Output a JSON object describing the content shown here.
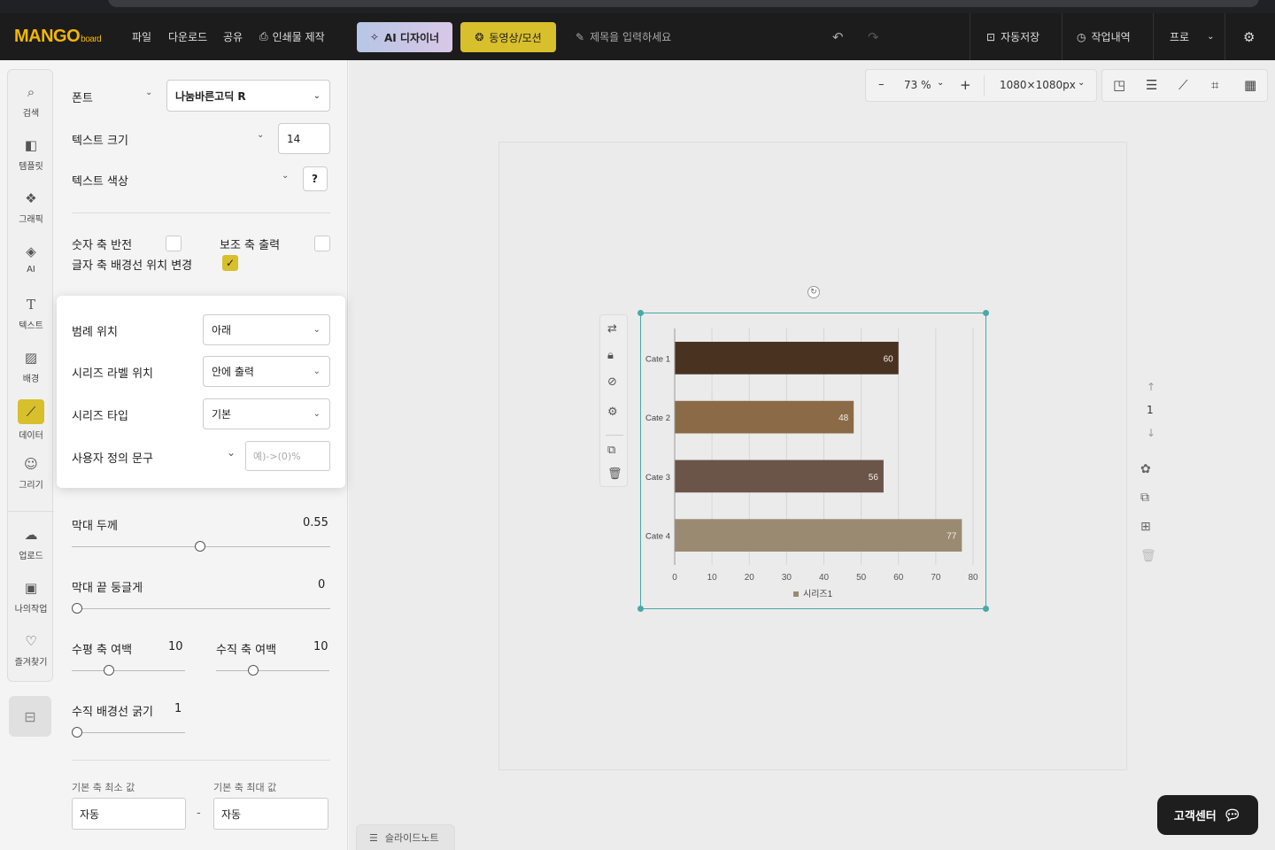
{
  "topbar": {
    "logo": "MANGO",
    "logo_suffix": "board",
    "menu": [
      "파일",
      "다운로드",
      "공유"
    ],
    "print_label": "인쇄물 제작",
    "ai_designer_label": "AI 디자이너",
    "motion_label": "동영상/모션",
    "title_placeholder": "제목을 입력하세요",
    "autosave_label": "자동저장",
    "history_label": "작업내역",
    "plan_label": "프로"
  },
  "nav": {
    "items": [
      {
        "label": "검색",
        "icon": "search-icon"
      },
      {
        "label": "템플릿",
        "icon": "template-icon"
      },
      {
        "label": "그래픽",
        "icon": "graphic-icon"
      },
      {
        "label": "AI",
        "icon": "ai-chip-icon"
      },
      {
        "label": "텍스트",
        "icon": "text-icon"
      },
      {
        "label": "배경",
        "icon": "background-icon"
      },
      {
        "label": "데이터",
        "icon": "chart-icon"
      },
      {
        "label": "그리기",
        "icon": "draw-icon"
      },
      {
        "label": "업로드",
        "icon": "upload-icon"
      },
      {
        "label": "나의작업",
        "icon": "my-work-icon"
      },
      {
        "label": "즐겨찾기",
        "icon": "favorite-icon"
      }
    ],
    "active": "데이터"
  },
  "panel": {
    "font_label": "폰트",
    "font_value": "나눔바른고딕 R",
    "text_size_label": "텍스트 크기",
    "text_size_value": "14",
    "text_color_label": "텍스트 색상",
    "text_color_btn": "?",
    "invert_axis_label": "숫자 축 반전",
    "sub_axis_label": "보조 축 출력",
    "bg_line_label": "글자 축 배경선 위치 변경",
    "bar_thickness_label": "막대 두께",
    "bar_thickness_value": "0.55",
    "bar_round_label": "막대 끝 둥글게",
    "bar_round_value": "0",
    "h_margin_label": "수평 축 여백",
    "h_margin_value": "10",
    "v_margin_label": "수직 축 여백",
    "v_margin_value": "10",
    "v_gridline_label": "수직 배경선 굵기",
    "v_gridline_value": "1",
    "min_label": "기본 축 최소 값",
    "max_label": "기본 축 최대 값",
    "min_value": "자동",
    "max_value": "자동",
    "dash": "-"
  },
  "popup": {
    "legend_pos_label": "범례 위치",
    "legend_pos_value": "아래",
    "series_label_pos_label": "시리즈 라벨 위치",
    "series_label_pos_value": "안에 출력",
    "series_type_label": "시리즈 타입",
    "series_type_value": "기본",
    "custom_text_label": "사용자 정의 문구",
    "custom_text_placeholder": "예)->(0)%"
  },
  "zoom": {
    "value": "73 %",
    "minus": "–",
    "plus": "+",
    "size": "1080×1080px"
  },
  "page_nav": {
    "current": "1"
  },
  "help_label": "고객센터",
  "slide_note_label": "슬라이드노트",
  "chart_data": {
    "type": "bar",
    "orientation": "horizontal",
    "categories": [
      "Cate 1",
      "Cate 2",
      "Cate 3",
      "Cate 4"
    ],
    "series": [
      {
        "name": "시리즈1",
        "values": [
          60,
          48,
          56,
          77
        ]
      }
    ],
    "bar_colors": [
      "#4a3221",
      "#8b6a47",
      "#6b5448",
      "#9b8a72"
    ],
    "xlim": [
      0,
      80
    ],
    "xticks": [
      "0",
      "10",
      "20",
      "30",
      "40",
      "50",
      "60",
      "70",
      "80"
    ],
    "grid": true,
    "legend": "bottom",
    "data_labels": "inside"
  },
  "colors": {
    "accent": "#d8bf2c",
    "selection": "#4aa8a8",
    "dark": "#1c1c1c"
  }
}
